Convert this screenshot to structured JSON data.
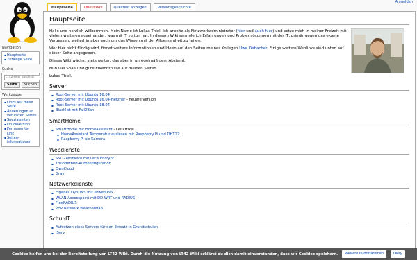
{
  "personal": {
    "login": "Anmelden"
  },
  "tabs": [
    {
      "label": "Hauptseite",
      "selected": true
    },
    {
      "label": "Diskussion",
      "red": true
    },
    {
      "label": "Quelltext anzeigen"
    },
    {
      "label": "Versionsgeschichte"
    }
  ],
  "sidebar": {
    "navigation": {
      "title": "Navigation",
      "items": [
        "Hauptseite",
        "Zufällige Seite"
      ]
    },
    "search": {
      "title": "Suche",
      "placeholder": "LT42-Wiki durchsu",
      "go": "Seite",
      "search": "Suchen"
    },
    "tools": {
      "title": "Werkzeuge",
      "items": [
        "Links auf diese Seite",
        "Änderungen an verlinkten Seiten",
        "Spezialseiten",
        "Druckversion",
        "Permanenter Link",
        "Seiten-informationen"
      ]
    }
  },
  "main": {
    "title": "Hauptseite",
    "intro": {
      "p1_before": "Hallo und herzlich willkommen. Mein Name ist Lukas Thiel. Ich arbeite als Netzwerkadministrator (",
      "p1_link1": "hier",
      "p1_mid1": " und ",
      "p1_link2": "auch hier",
      "p1_after": ") und setze mich in meiner Freizeit mit vielem weiteren auseinander, was mit IT zu tun hat. In diesem Wiki sammle ich Erfahrungen und Problemlösungen mit der IT, primär gegen das eigene Vergessen, weiterhin aber auch um das Wissen mit der Allgemeinheit zu teilen.",
      "p2_before": "Wer hier nicht fündig wird, findet weitere Informationen und Ideen auf den Seiten meines Kollegen ",
      "p2_link": "Uwe Debacher",
      "p2_after": ". Einige weitere Weblinks sind unten auf dieser Seite angegeben.",
      "p3": "Dieses Wiki wächst stets weiter, das aber in unregelmäßigem Abstand.",
      "p4": "Nun viel Spaß und gute Erkenntnisse auf meinen Seiten.",
      "p5": "Lukas Thiel."
    },
    "sections": {
      "server": {
        "title": "Server",
        "items": [
          {
            "link": "Root-Server mit Ubuntu 16.04",
            "suffix": ""
          },
          {
            "link": "Root-Server mit Ubuntu 16.04-Hetzner",
            "suffix": " - neuere Version"
          },
          {
            "link": "Root-Server mit Ubuntu 18.04",
            "suffix": ""
          },
          {
            "link": "Blacklist mit Fail2Ban",
            "suffix": ""
          }
        ]
      },
      "smarthome": {
        "title": "SmartHome",
        "item": {
          "link": "SmartHome mit HomeAssistant",
          "suffix": " - Leitartikel"
        },
        "subitems": [
          "HomeAssistant Temperatur auslesen mit Raspberry Pi und DHT22",
          "Raspberry Pi als Kamera"
        ]
      },
      "webdienste": {
        "title": "Webdienste",
        "items": [
          "SSL-Zertifikate mit Let's Encrypt",
          "Thunderbird-Autokonfiguration",
          "OwnCloud",
          "Grav"
        ]
      },
      "netzwerk": {
        "title": "Netzwerkdienste",
        "items": [
          "Eigenes DynDNS mit PowerDNS",
          "WLAN-Accesspoint mit DD-WRT und RADIUS",
          "FreeRADIUS",
          "PHP Network WeatherMap"
        ]
      },
      "schul": {
        "title": "Schul-IT",
        "items": [
          "Aufsetzen eines Servers für den Einsatz in Grundschulen",
          "IServ"
        ]
      }
    }
  },
  "cookie": {
    "text": "Cookies helfen uns bei der Bereitstellung von LT42-Wiki. Durch die Nutzung von LT42-Wiki erklärst du dich damit einverstanden, dass wir Cookies speichern.",
    "more": "Weitere Informationen",
    "ok": "Okay"
  }
}
